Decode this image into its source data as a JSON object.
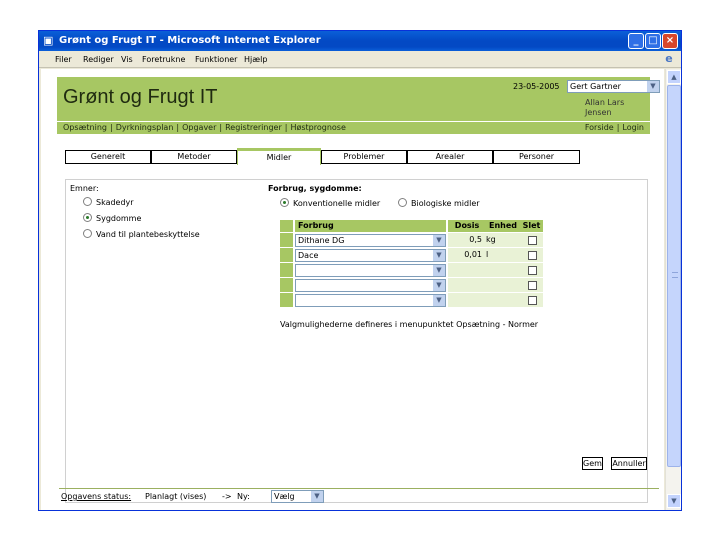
{
  "window": {
    "title": "Grønt og Frugt IT - Microsoft Internet Explorer"
  },
  "menu": [
    "Filer",
    "Rediger",
    "Vis",
    "Foretrukne",
    "Funktioner",
    "Hjælp"
  ],
  "header": {
    "site_title": "Grønt og Frugt IT",
    "date": "23-05-2005",
    "user_select": "Gert Gartner",
    "user_fullname": "Allan Lars Jensen"
  },
  "nav": {
    "left": [
      "Opsætning",
      "Dyrkningsplan",
      "Opgaver",
      "Registreringer",
      "Høstprognose"
    ],
    "right": [
      "Forside",
      "Login"
    ]
  },
  "tabs": [
    "Generelt",
    "Metoder",
    "Midler",
    "Problemer",
    "Arealer",
    "Personer"
  ],
  "emner": {
    "label": "Emner:",
    "options": [
      "Skadedyr",
      "Sygdomme",
      "Vand til plantebeskyttelse"
    ],
    "selected_index": 1
  },
  "forbrug": {
    "label": "Forbrug, sygdomme:",
    "options": [
      "Konventionelle midler",
      "Biologiske midler"
    ],
    "selected_index": 0
  },
  "grid": {
    "columns": {
      "product": "Forbrug",
      "dose": "Dosis",
      "unit": "Enhed",
      "delete": "Slet"
    },
    "rows": [
      {
        "product": "Dithane DG",
        "dose": "0,5",
        "unit": "kg"
      },
      {
        "product": "Dace",
        "dose": "0,01",
        "unit": "l"
      },
      {
        "product": "",
        "dose": "",
        "unit": ""
      },
      {
        "product": "",
        "dose": "",
        "unit": ""
      },
      {
        "product": "",
        "dose": "",
        "unit": ""
      }
    ]
  },
  "help_text": "Valgmulighederne defineres i menupunktet Opsætning - Normer",
  "buttons": {
    "save": "Gem",
    "cancel": "Annuller"
  },
  "status": {
    "label": "Opgavens status:",
    "current": "Planlagt (vises)",
    "arrow": "->",
    "next_label": "Ny:",
    "select_value": "Vælg"
  }
}
